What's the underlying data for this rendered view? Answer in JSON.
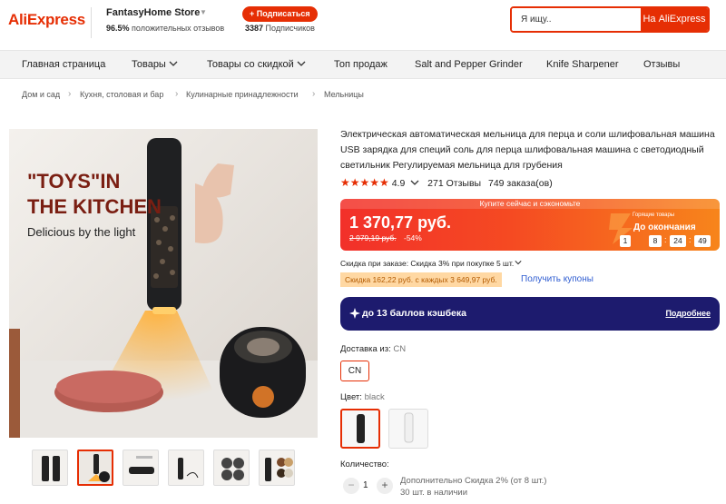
{
  "header": {
    "logo": "AliExpress",
    "store_name": "FantasyHome Store",
    "rating_value": "96.5%",
    "rating_text": "положительных отзывов",
    "subscribe_label": "+ Подписаться",
    "subscribers_count": "3387",
    "subscribers_text": "Подписчиков",
    "search_placeholder": "Я ищу..",
    "search_button": "На AliExpress"
  },
  "nav": {
    "items": [
      "Главная страница",
      "Товары",
      "Товары со скидкой",
      "Топ продаж",
      "Salt and Pepper Grinder",
      "Knife Sharpener",
      "Отзывы"
    ]
  },
  "breadcrumbs": [
    "Дом и сад",
    "Кухня, столовая и бар",
    "Кулинарные принадлежности",
    "Мельницы"
  ],
  "image": {
    "headline_line1": "\"TOYS\"IN",
    "headline_line2": "THE KITCHEN",
    "subline": "Delicious by the light",
    "thumbnail_count": 6,
    "active_thumbnail": 2
  },
  "product": {
    "title": "Электрическая автоматическая мельница для перца и соли шлифовальная машина USB зарядка для специй соль для перца шлифовальная машина с светодиодный светильник Регулируемая мельница для грубения",
    "stars": 5,
    "rating": "4.9",
    "reviews": "271 Отзывы",
    "orders": "749 заказа(ов)"
  },
  "promo": {
    "banner": "Купите сейчас и сэкономьте",
    "price": "1 370,77 руб.",
    "old_price": "2 979,19 руб.",
    "discount": "-54%",
    "hot_label": "Горящие товары",
    "ends_label": "До окончания",
    "timer": [
      "1",
      "8",
      "24",
      "49"
    ]
  },
  "discounts": {
    "order_discount": "Скидка при заказе: Скидка 3% при покупке 5 шт.",
    "coupon_tag": "Скидка 162,22 руб. с каждых 3 649,97 руб.",
    "coupon_link": "Получить купоны"
  },
  "cashback": {
    "text": "до 13 баллов кэшбека",
    "more": "Подробнее"
  },
  "shipping": {
    "label": "Доставка из:",
    "value": "CN",
    "option": "CN"
  },
  "color": {
    "label": "Цвет:",
    "value": "black",
    "options": [
      "black",
      "white"
    ]
  },
  "quantity": {
    "label": "Количество:",
    "minus": "−",
    "value": "1",
    "plus": "+",
    "extra_discount": "Дополнительно Скидка 2% (от 8 шт.)",
    "stock": "30 шт. в наличии"
  },
  "colors": {
    "brand": "#e62e04",
    "cashback_bg": "#1d1b6e",
    "link": "#2e5cd1"
  }
}
